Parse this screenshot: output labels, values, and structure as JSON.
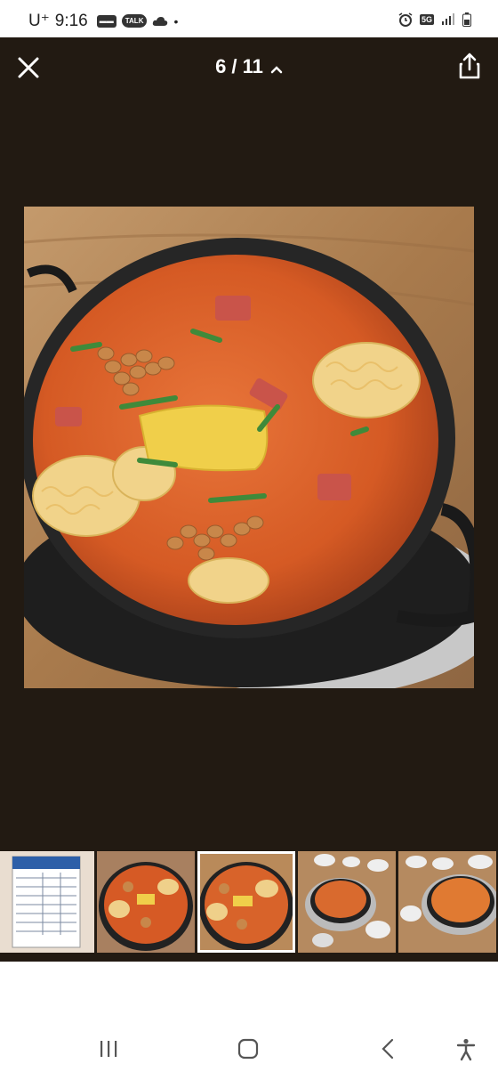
{
  "status_bar": {
    "carrier": "U⁺",
    "time": "9:16",
    "network": "5G"
  },
  "viewer": {
    "counter": "6 / 11",
    "icons": {
      "close": "close-icon",
      "chevron": "chevron-up-icon",
      "share": "share-icon"
    }
  },
  "photo": {
    "subject": "budae-jjigae-stew"
  },
  "thumbnails": [
    {
      "subject": "menu-board",
      "active": false
    },
    {
      "subject": "stew-pot",
      "active": false
    },
    {
      "subject": "stew-pot",
      "active": true
    },
    {
      "subject": "table-setting",
      "active": false
    },
    {
      "subject": "table-setting",
      "active": false
    }
  ],
  "nav_bar": {
    "icons": [
      "recent-apps-icon",
      "home-icon",
      "back-icon",
      "accessibility-icon"
    ]
  },
  "colors": {
    "viewer_bg": "#221a12",
    "stew": "#d9642a"
  }
}
